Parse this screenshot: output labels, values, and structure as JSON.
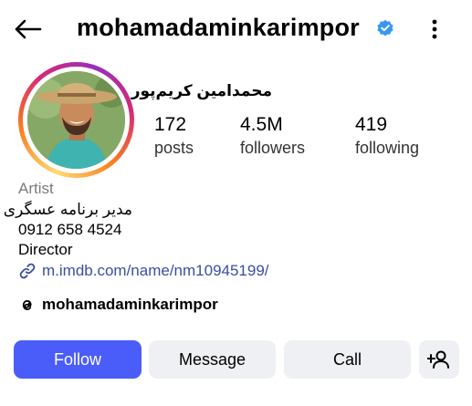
{
  "header": {
    "username": "mohamadaminkarimpor",
    "back_icon": "back-arrow-icon",
    "verified_icon": "verified-badge-icon",
    "more_icon": "more-vertical-icon",
    "verified_color": "#3897f0"
  },
  "profile": {
    "display_name": "محمدامین کریم‌پور",
    "stats": {
      "posts": {
        "value": "172",
        "label": "posts"
      },
      "followers": {
        "value": "4.5M",
        "label": "followers"
      },
      "following": {
        "value": "419",
        "label": "following"
      }
    },
    "bio": {
      "category": "Artist",
      "line1": "مدیر برنامه عسگری",
      "phone": "0912 658 4524",
      "line3": "Director"
    },
    "link": {
      "icon": "link-icon",
      "text": "m.imdb.com/name/nm10945199/"
    },
    "threads": {
      "icon": "threads-icon",
      "handle": "mohamadaminkarimpor"
    }
  },
  "actions": {
    "follow": "Follow",
    "message": "Message",
    "call": "Call",
    "add_user_icon": "add-user-icon"
  },
  "colors": {
    "accent": "#4a5df9",
    "link": "#3a4fa0",
    "button_secondary": "#eff0f3"
  }
}
